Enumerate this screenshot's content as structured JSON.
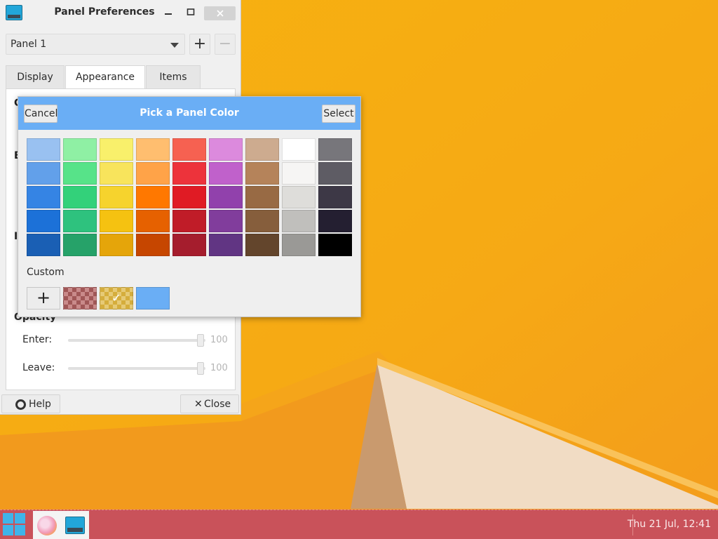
{
  "prefs_window": {
    "title": "Panel Preferences",
    "panel_select": "Panel 1",
    "add_symbol": "+",
    "remove_symbol": "−",
    "tabs": [
      "Display",
      "Appearance",
      "Items"
    ],
    "active_tab": "Appearance",
    "partial_labels": [
      "G",
      "B",
      "I"
    ],
    "opacity_heading": "Opacity",
    "sliders": [
      {
        "label": "Enter:",
        "value": "100"
      },
      {
        "label": "Leave:",
        "value": "100"
      }
    ],
    "help_label": "Help",
    "close_label": "Close"
  },
  "color_dialog": {
    "title": "Pick a Panel Color",
    "cancel_label": "Cancel",
    "select_label": "Select",
    "custom_label": "Custom",
    "add_custom_symbol": "+",
    "check_symbol": "✓",
    "swatch_columns": [
      [
        "#99c1f1",
        "#62a0ea",
        "#3584e4",
        "#1c71d8",
        "#1a5fb4"
      ],
      [
        "#8ff0a4",
        "#57e389",
        "#33d17a",
        "#2ec27e",
        "#26a269"
      ],
      [
        "#f9f06b",
        "#f8e45c",
        "#f6d32d",
        "#f5c211",
        "#e5a50a"
      ],
      [
        "#ffbe6f",
        "#ffa348",
        "#ff7800",
        "#e66100",
        "#c64600"
      ],
      [
        "#f66151",
        "#ed333b",
        "#e01b24",
        "#c01c28",
        "#a51d2d"
      ],
      [
        "#dc8add",
        "#c061cb",
        "#9141ac",
        "#813d9c",
        "#613583"
      ],
      [
        "#cdab8f",
        "#b5835a",
        "#986a44",
        "#865e3c",
        "#63452c"
      ],
      [
        "#ffffff",
        "#f6f5f4",
        "#deddda",
        "#c0bfbc",
        "#9a9996"
      ],
      [
        "#77767b",
        "#5e5c64",
        "#3d3846",
        "#241f31",
        "#000000"
      ]
    ],
    "custom_colors": [
      "#a05757",
      "#d5ad3c",
      "#6aaef5"
    ]
  },
  "taskbar": {
    "clock": "Thu 21 Jul, 12:41",
    "color": "#c9525a"
  }
}
